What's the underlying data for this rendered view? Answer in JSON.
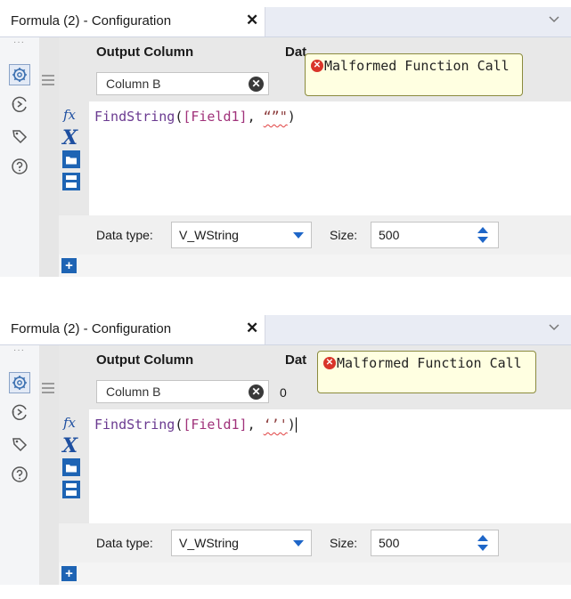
{
  "panels": [
    {
      "tab_title": "Formula (2) - Configuration",
      "header_output_column": "Output Column",
      "header_data_preview": "Dat",
      "column_value": "Column B",
      "preview_value": "",
      "expression": {
        "fn": "FindString",
        "open": "(",
        "field": "[Field1]",
        "sep": ", ",
        "arg": "“”\"",
        "close": ")"
      },
      "tooltip": "Malformed Function Call",
      "data_type_label": "Data type:",
      "data_type_value": "V_WString",
      "size_label": "Size:",
      "size_value": "500"
    },
    {
      "tab_title": "Formula (2) - Configuration",
      "header_output_column": "Output Column",
      "header_data_preview": "Dat",
      "column_value": "Column B",
      "preview_value": "0",
      "expression": {
        "fn": "FindString",
        "open": "(",
        "field": "[Field1]",
        "sep": ", ",
        "arg": "‘’'",
        "close": ")"
      },
      "tooltip": "Malformed Function Call",
      "data_type_label": "Data type:",
      "data_type_value": "V_WString",
      "size_label": "Size:",
      "size_value": "500"
    }
  ],
  "icons": {
    "tab_close": "✕",
    "clear": "✕",
    "error": "✕",
    "add": "+",
    "sidebar": [
      "gear-icon",
      "connection-icon",
      "tag-icon",
      "help-icon"
    ],
    "tools": [
      "function-icon",
      "variable-icon",
      "open-folder-icon",
      "save-icon"
    ]
  },
  "colors": {
    "accent": "#1e64b4",
    "error": "#d9352a",
    "tooltip_bg": "#ffffe1"
  }
}
